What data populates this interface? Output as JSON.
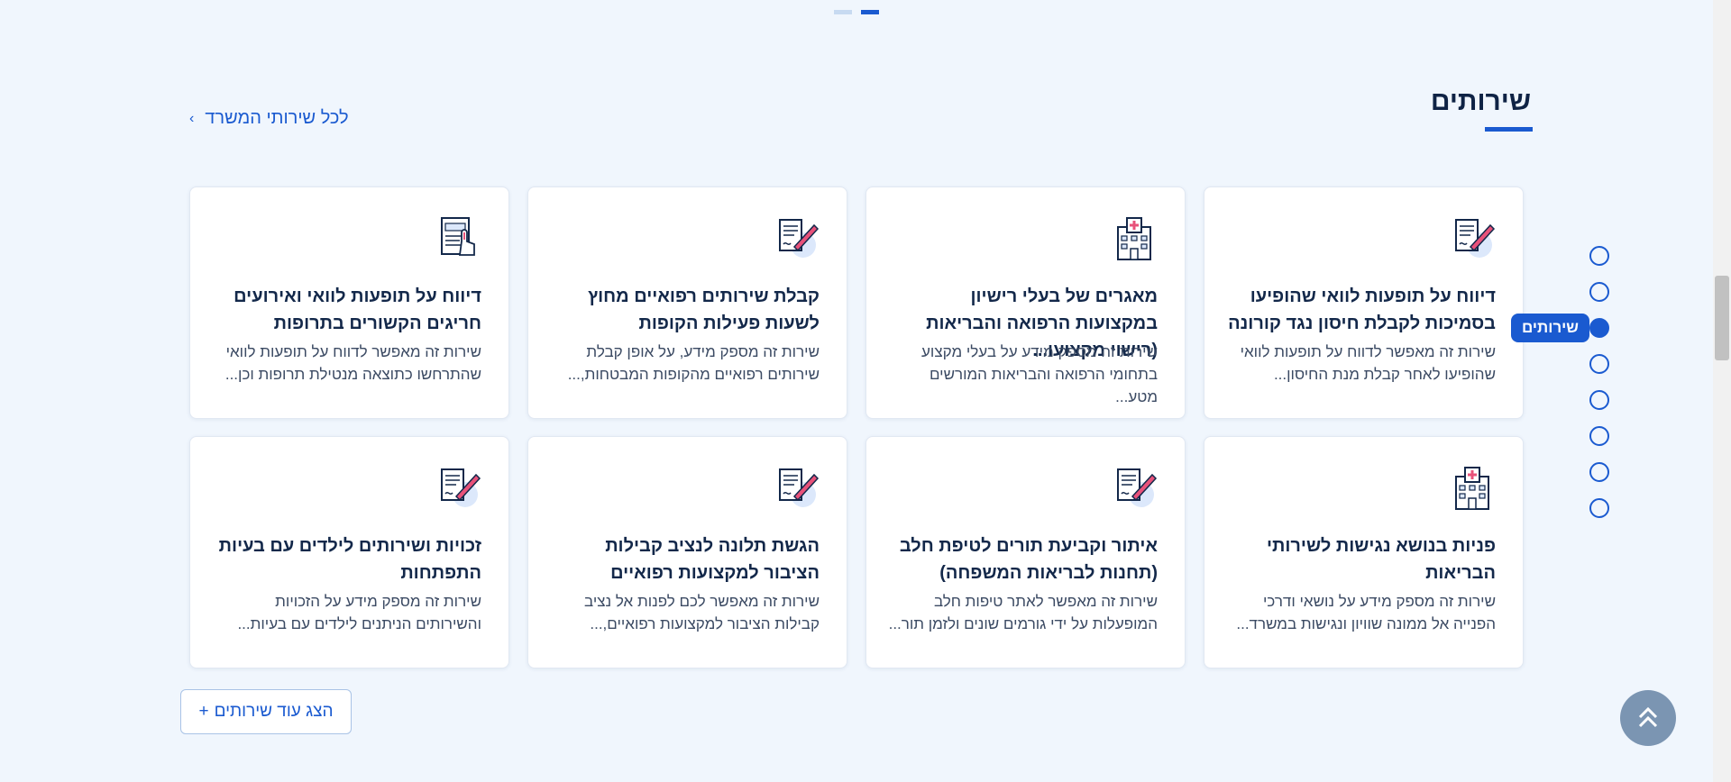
{
  "section": {
    "title": "שירותים",
    "all_services_link": "לכל שירותי המשרד",
    "show_more": "הצג עוד שירותים"
  },
  "cards": [
    {
      "icon": "document-pen-icon",
      "title": "דיווח על תופעות לוואי שהופיעו בסמיכות לקבלת חיסון נגד קורונה",
      "desc": "שירות זה מאפשר לדווח על תופעות לוואי שהופיעו לאחר קבלת מנת החיסון..."
    },
    {
      "icon": "hospital-icon",
      "title": "מאגרים של בעלי רישיון במקצועות הרפואה והבריאות (רישוי מקצועו...",
      "desc": "שירות זה מספק מידע על בעלי מקצוע בתחומי הרפואה והבריאות המורשים מטע..."
    },
    {
      "icon": "document-pen-icon",
      "title": "קבלת שירותים רפואיים מחוץ לשעות פעילות הקופות",
      "desc": "שירות זה מספק מידע, על אופן קבלת שירותים רפואיים מהקופות המבטחות,..."
    },
    {
      "icon": "form-hand-icon",
      "title": "דיווח על תופעות לוואי ואירועים חריגים הקשורים בתרופות",
      "desc": "שירות זה מאפשר לדווח על תופעות לוואי שהתרחשו כתוצאה מנטילת תרופות וכן..."
    },
    {
      "icon": "hospital-icon",
      "title": "פניות בנושא נגישות לשירותי הבריאות",
      "desc": "שירות זה מספק מידע על נושאי ודרכי הפנייה אל ממונה שוויון ונגישות במשרד..."
    },
    {
      "icon": "document-pen-icon",
      "title": "איתור וקביעת תורים לטיפת חלב (תחנות לבריאות המשפחה)",
      "desc": "שירות זה מאפשר לאתר טיפות חלב המופעלות על ידי גורמים שונים ולזמן תור..."
    },
    {
      "icon": "document-pen-icon",
      "title": "הגשת תלונה לנציב קבילות הציבור למקצועות רפואיים",
      "desc": "שירות זה מאפשר לכם לפנות אל נציב קבילות הציבור למקצועות רפואיים,..."
    },
    {
      "icon": "document-pen-icon",
      "title": "זכויות ושירותים לילדים עם בעיות התפתחות",
      "desc": "שירות זה מספק מידע על הזכויות והשירותים הניתנים לילדים עם בעיות..."
    }
  ],
  "side_nav": {
    "active_label": "שירותים",
    "active_index": 2,
    "count": 8
  },
  "colors": {
    "accent": "#1a5ad0",
    "background": "#f0f6fd",
    "icon_pink": "#e8527a"
  }
}
